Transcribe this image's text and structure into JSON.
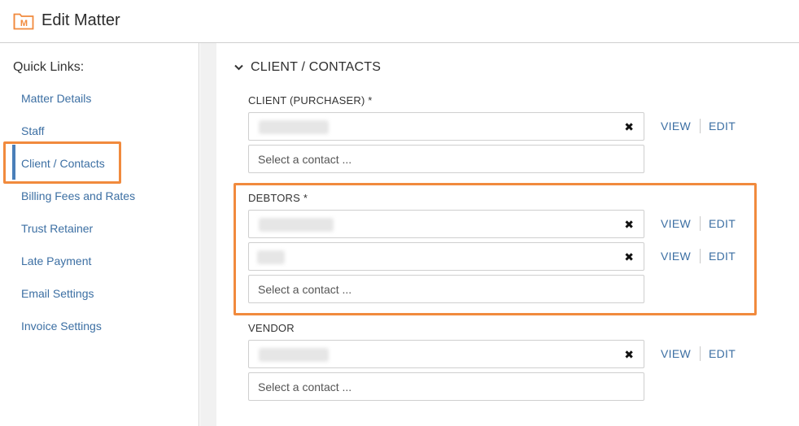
{
  "header": {
    "title": "Edit Matter",
    "logo_icon": "matter-folder-icon",
    "logo_letter": "M"
  },
  "sidebar": {
    "title": "Quick Links:",
    "items": [
      {
        "label": "Matter Details"
      },
      {
        "label": "Staff"
      },
      {
        "label": "Client / Contacts",
        "active": true
      },
      {
        "label": "Billing Fees and Rates"
      },
      {
        "label": "Trust Retainer"
      },
      {
        "label": "Late Payment"
      },
      {
        "label": "Email Settings"
      },
      {
        "label": "Invoice Settings"
      }
    ]
  },
  "main": {
    "section_title": "CLIENT / CONTACTS",
    "client": {
      "label": "CLIENT (PURCHASER) *",
      "placeholder": "Select a contact ...",
      "view": "VIEW",
      "edit": "EDIT"
    },
    "debtors": {
      "label": "DEBTORS *",
      "placeholder": "Select a contact ...",
      "view": "VIEW",
      "edit": "EDIT"
    },
    "vendor": {
      "label": "VENDOR",
      "placeholder": "Select a contact ...",
      "view": "VIEW",
      "edit": "EDIT"
    }
  },
  "colors": {
    "accent": "#f18a3d",
    "link": "#3c6fa3",
    "active_bar": "#4a7fb9"
  }
}
